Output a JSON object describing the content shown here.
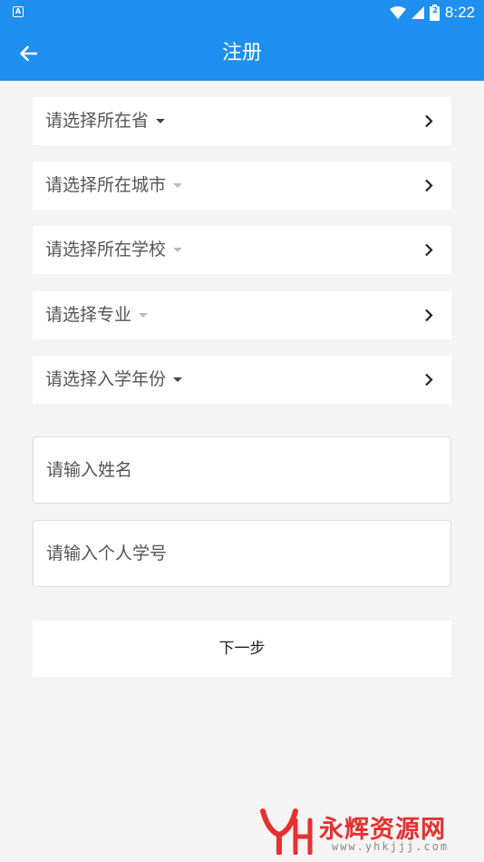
{
  "status_bar": {
    "notification_icon_letter": "A",
    "time": "8:22",
    "battery_badge": "2"
  },
  "app_bar": {
    "title": "注册",
    "back_icon": "arrow-left-icon"
  },
  "selects": [
    {
      "label": "请选择所在省",
      "enabled": true
    },
    {
      "label": "请选择所在城市",
      "enabled": false
    },
    {
      "label": "请选择所在学校",
      "enabled": false
    },
    {
      "label": "请选择专业",
      "enabled": false
    },
    {
      "label": "请选择入学年份",
      "enabled": true
    }
  ],
  "inputs": {
    "name_placeholder": "请输入姓名",
    "student_id_placeholder": "请输入个人学号"
  },
  "next_button": {
    "label": "下一步"
  },
  "watermark": {
    "name": "永辉资源网",
    "url": "www.yhkjjj.com"
  },
  "colors": {
    "primary": "#1f8ff0",
    "background": "#f4f4f4",
    "watermark_red": "#e8302f"
  }
}
